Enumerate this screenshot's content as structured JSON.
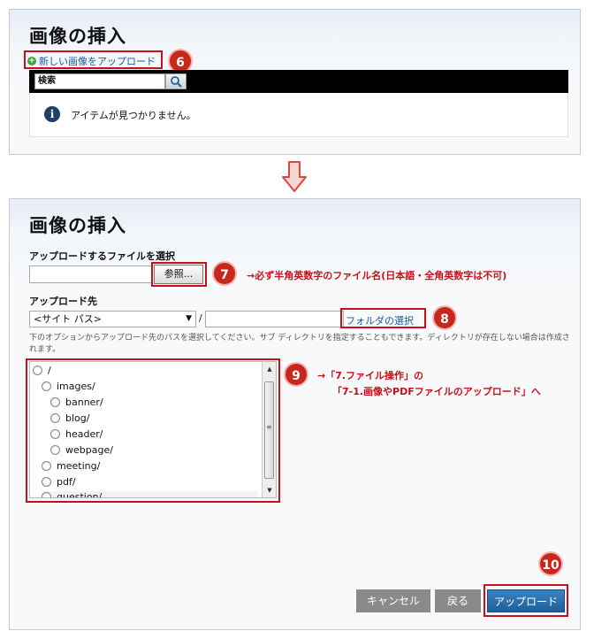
{
  "top_panel": {
    "title": "画像の挿入",
    "upload_new_link": "新しい画像をアップロード",
    "search_input_value": "検索",
    "empty_message": "アイテムが見つかりません。",
    "step6": "6"
  },
  "bottom_panel": {
    "title": "画像の挿入",
    "select_file_label": "アップロードするファイルを選択",
    "browse_button": "参照...",
    "step7": "7",
    "note7": "→必ず半角英数字のファイル名(日本語・全角英数字は不可)",
    "destination_label": "アップロード先",
    "path_select_value": "<サイト パス>",
    "slash": "/",
    "select_folder_link": "フォルダの選択",
    "step8": "8",
    "help_text": "下のオプションからアップロード先のパスを選択してください。サブ ディレクトリを指定することもできます。ディレクトリが存在しない場合は作成されます。",
    "step9": "9",
    "note9_line1": "→「7.ファイル操作」の",
    "note9_line2": "「7-1.画像やPDFファイルのアップロード」へ",
    "tree": [
      {
        "label": "/",
        "level": 0
      },
      {
        "label": "images/",
        "level": 1
      },
      {
        "label": "banner/",
        "level": 2
      },
      {
        "label": "blog/",
        "level": 2
      },
      {
        "label": "header/",
        "level": 2
      },
      {
        "label": "webpage/",
        "level": 2
      },
      {
        "label": "meeting/",
        "level": 1
      },
      {
        "label": "pdf/",
        "level": 1
      },
      {
        "label": "question/",
        "level": 1
      }
    ],
    "cancel_button": "キャンセル",
    "back_button": "戻る",
    "upload_button": "アップロード",
    "step10": "10"
  },
  "colors": {
    "accent_red": "#c8101a",
    "badge_red": "#c8271d",
    "link_blue": "#1a5aa0",
    "upload_blue": "#1f5f99"
  }
}
